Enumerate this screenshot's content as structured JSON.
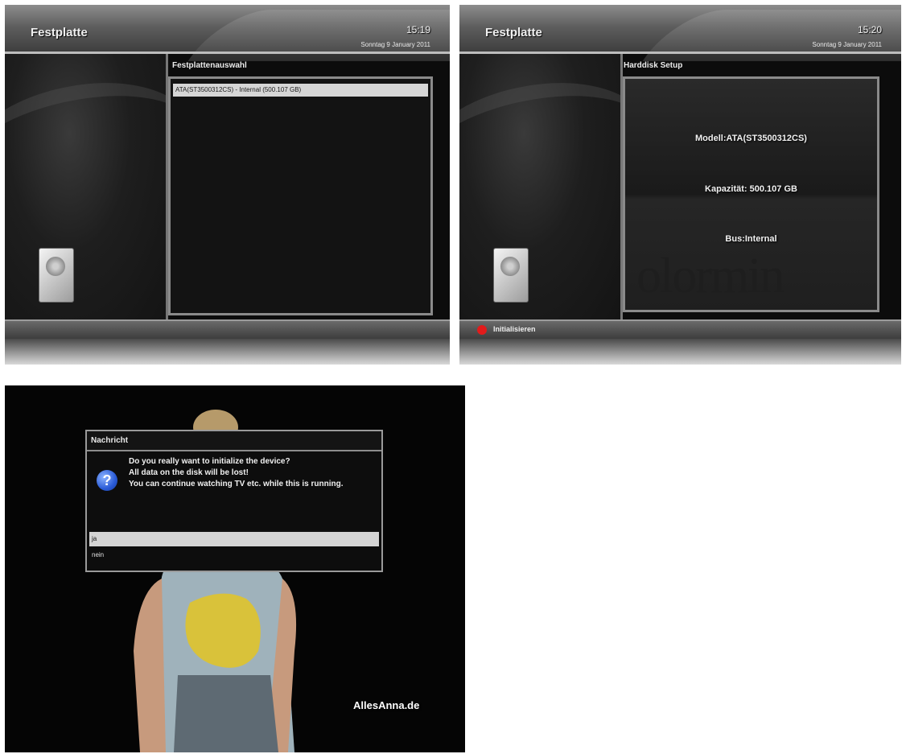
{
  "screen1": {
    "header": {
      "title": "Festplatte",
      "time": "15:19",
      "date": "Sonntag 9 January 2011"
    },
    "panel_title": "Festplattenauswahl",
    "list_items": [
      {
        "label": "ATA(ST3500312CS) - Internal (500.107 GB)"
      }
    ]
  },
  "screen2": {
    "header": {
      "title": "Festplatte",
      "time": "15:20",
      "date": "Sonntag 9 January 2011"
    },
    "panel_title": "Harddisk Setup",
    "info": {
      "model": "Modell:ATA(ST3500312CS)",
      "capacity": "Kapazität: 500.107 GB",
      "bus": "Bus:Internal"
    },
    "background_text": "olormin",
    "red_button_label": "Initialisieren"
  },
  "dialog": {
    "title": "Nachricht",
    "message_lines": [
      "Do you really want to initialize the device?",
      "All data on the disk will be lost!",
      "You can continue watching TV etc. while this is running."
    ],
    "options": [
      {
        "label": "ja",
        "selected": true
      },
      {
        "label": "nein",
        "selected": false
      }
    ],
    "icon": "question-icon"
  },
  "watermark": "AllesAnna.de",
  "colors": {
    "red_button": "#e21b1b",
    "selection": "#d6d6d6",
    "question_icon": "#2a5bd7"
  }
}
